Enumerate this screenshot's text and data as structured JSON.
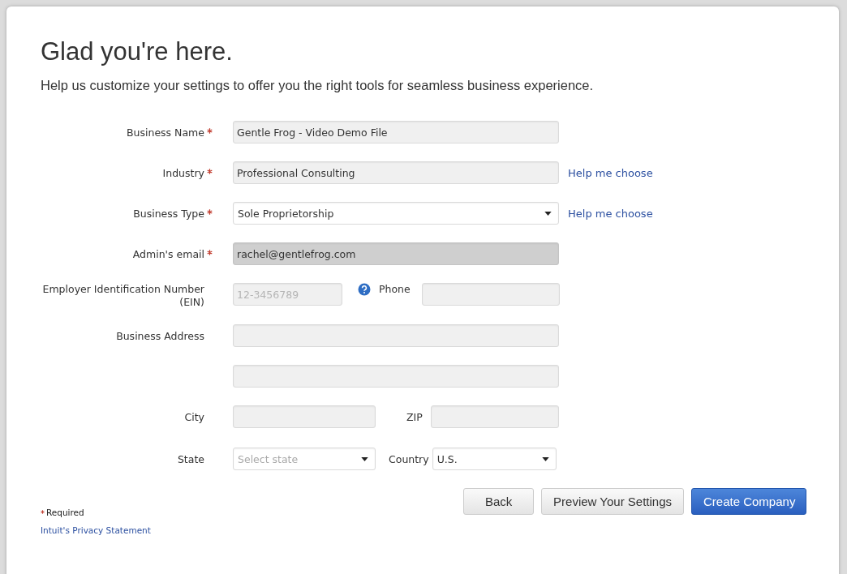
{
  "heading": "Glad you're here.",
  "subheading": "Help us customize your settings to offer you the right tools for seamless business experience.",
  "business_name": {
    "label": "Business Name",
    "required": true,
    "value": "Gentle Frog - Video Demo File"
  },
  "industry": {
    "label": "Industry",
    "required": true,
    "value": "Professional Consulting",
    "help_link": "Help me choose"
  },
  "business_type": {
    "label": "Business Type",
    "required": true,
    "value": "Sole Proprietorship",
    "help_link": "Help me choose"
  },
  "admin_email": {
    "label": "Admin's email",
    "required": true,
    "value": "rachel@gentlefrog.com",
    "disabled": true
  },
  "ein": {
    "label": "Employer Identification Number (EIN)",
    "placeholder": "12-3456789"
  },
  "phone": {
    "label": "Phone"
  },
  "business_address": {
    "label": "Business Address"
  },
  "city": {
    "label": "City"
  },
  "zip": {
    "label": "ZIP"
  },
  "state": {
    "label": "State",
    "placeholder": "Select state"
  },
  "country": {
    "label": "Country",
    "value": "U.S."
  },
  "required_note": "Required",
  "privacy_link": "Intuit's Privacy Statement",
  "buttons": [
    {
      "label": "Back",
      "kind": "secondary"
    },
    {
      "label": "Preview Your Settings",
      "kind": "secondary"
    },
    {
      "label": "Create Company",
      "kind": "primary"
    }
  ]
}
